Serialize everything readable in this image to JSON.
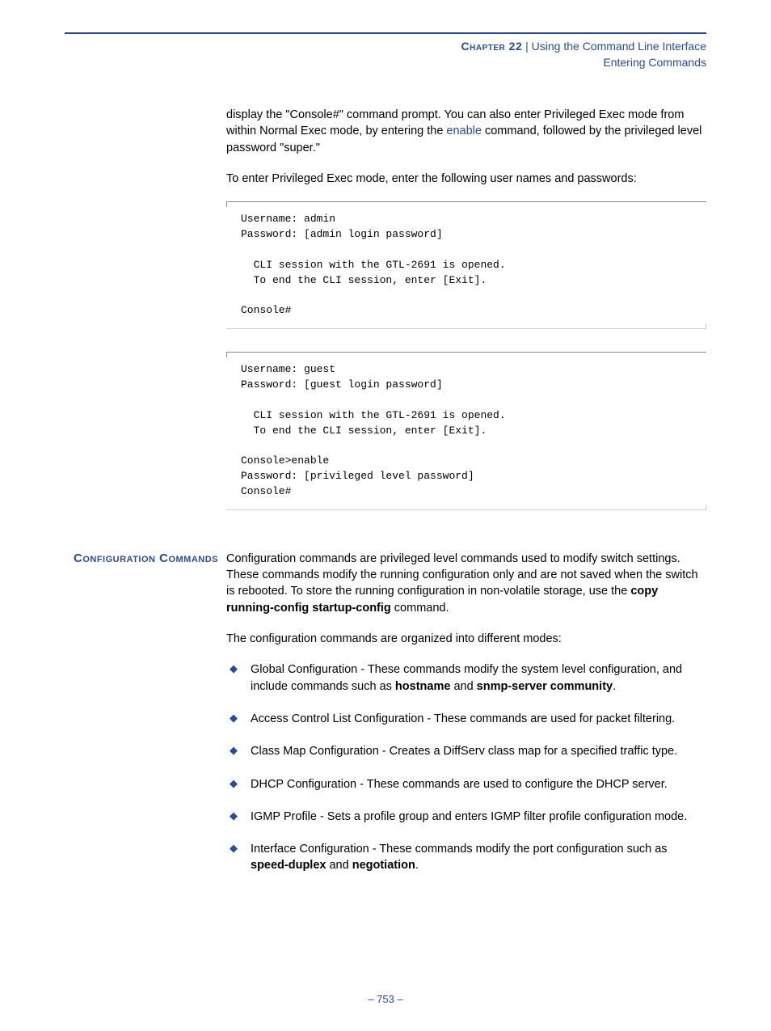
{
  "header": {
    "chapter_label": "Chapter 22",
    "separator": "  |  ",
    "chapter_title": "Using the Command Line Interface",
    "subtitle": "Entering Commands"
  },
  "intro": {
    "para1_a": "display the \"Console#\" command prompt. You can also enter Privileged Exec mode from within Normal Exec mode, by entering the ",
    "para1_link": "enable",
    "para1_b": " command, followed by the privileged level password \"super.\"",
    "para2": "To enter Privileged Exec mode, enter the following user names and passwords:"
  },
  "code1": "Username: admin\nPassword: [admin login password]\n\n  CLI session with the GTL-2691 is opened.\n  To end the CLI session, enter [Exit].\n\nConsole#",
  "code2": "Username: guest\nPassword: [guest login password]\n\n  CLI session with the GTL-2691 is opened.\n  To end the CLI session, enter [Exit].\n\nConsole>enable\nPassword: [privileged level password]\nConsole#",
  "section": {
    "heading": "Configuration Commands",
    "para1_a": "Configuration commands are privileged level commands used to modify switch settings. These commands modify the running configuration only and are not saved when the switch is rebooted. To store the running configuration in non-volatile storage, use the ",
    "para1_b1": "copy running-config startup-config",
    "para1_c": " command.",
    "para2": "The configuration commands are organized into different modes:",
    "items": [
      {
        "a": "Global Configuration - These commands modify the system level configuration, and include commands such as ",
        "b1": "hostname",
        "mid": " and ",
        "b2": "snmp-server community",
        "c": "."
      },
      {
        "a": "Access Control List Configuration - These commands are used for packet filtering.",
        "b1": "",
        "mid": "",
        "b2": "",
        "c": ""
      },
      {
        "a": "Class Map Configuration - Creates a DiffServ class map for a specified traffic type.",
        "b1": "",
        "mid": "",
        "b2": "",
        "c": ""
      },
      {
        "a": "DHCP Configuration - These commands are used to configure the DHCP server.",
        "b1": "",
        "mid": "",
        "b2": "",
        "c": ""
      },
      {
        "a": "IGMP Profile - Sets a profile group and enters IGMP filter profile configuration mode.",
        "b1": "",
        "mid": "",
        "b2": "",
        "c": ""
      },
      {
        "a": "Interface Configuration - These commands modify the port configuration such as ",
        "b1": "speed-duplex",
        "mid": " and ",
        "b2": "negotiation",
        "c": "."
      }
    ]
  },
  "footer": {
    "page": "– 753 –"
  }
}
